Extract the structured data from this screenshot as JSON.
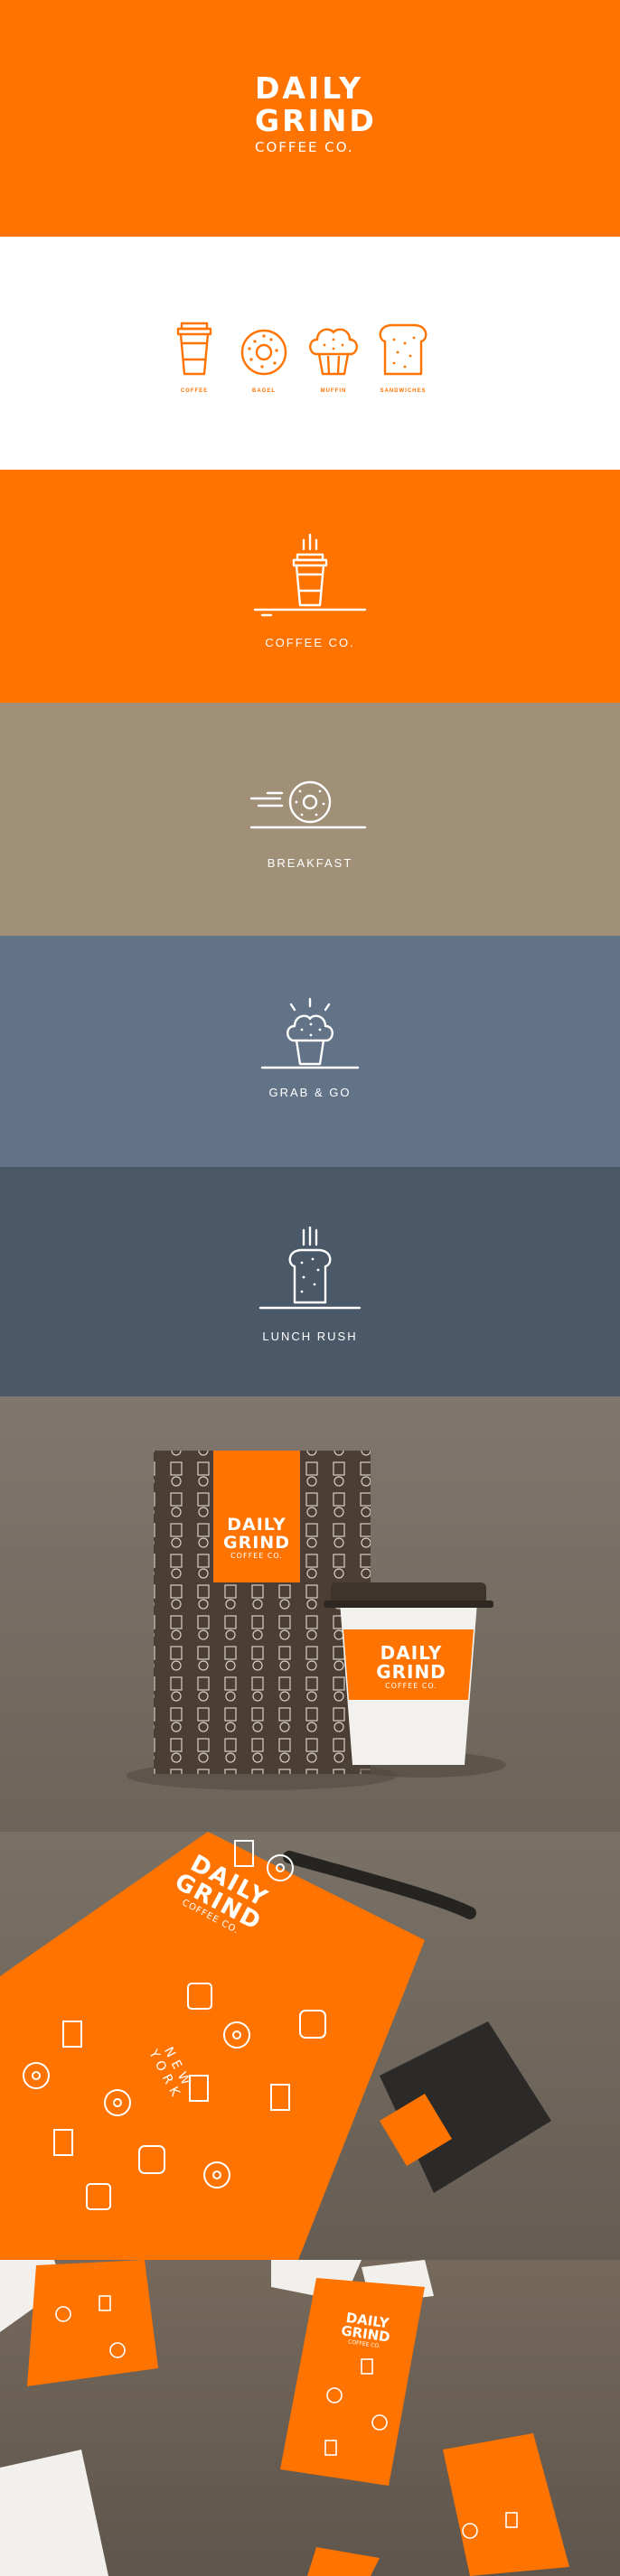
{
  "logo": {
    "line1": "DAILY",
    "line2": "GRIND",
    "line3": "COFFEE CO."
  },
  "icons": [
    {
      "name": "coffee-cup-icon",
      "label": "COFFEE"
    },
    {
      "name": "bagel-icon",
      "label": "BAGEL"
    },
    {
      "name": "muffin-icon",
      "label": "MUFFIN"
    },
    {
      "name": "sandwich-bread-icon",
      "label": "SANDWICHES"
    }
  ],
  "banners": [
    {
      "caption": "COFFEE CO.",
      "color": "#ff7300"
    },
    {
      "caption": "BREAKFAST",
      "color": "#a09078"
    },
    {
      "caption": "GRAB & GO",
      "color": "#627388"
    },
    {
      "caption": "LUNCH RUSH",
      "color": "#4a5868"
    }
  ],
  "mockup": {
    "pouch_logo": {
      "line1": "DAILY",
      "line2": "GRIND",
      "line3": "COFFEE CO."
    },
    "cup_logo": {
      "line1": "DAILY",
      "line2": "GRIND",
      "line3": "COFFEE CO."
    },
    "bag_logo": {
      "line1": "DAILY",
      "line2": "GRIND",
      "line3": "COFFEE CO."
    },
    "bag_city": "NEW YORK",
    "card_logo": {
      "line1": "DAILY",
      "line2": "GRIND",
      "line3": "COFFEE CO."
    }
  },
  "colors": {
    "brand_orange": "#ff7300",
    "white": "#ffffff"
  }
}
